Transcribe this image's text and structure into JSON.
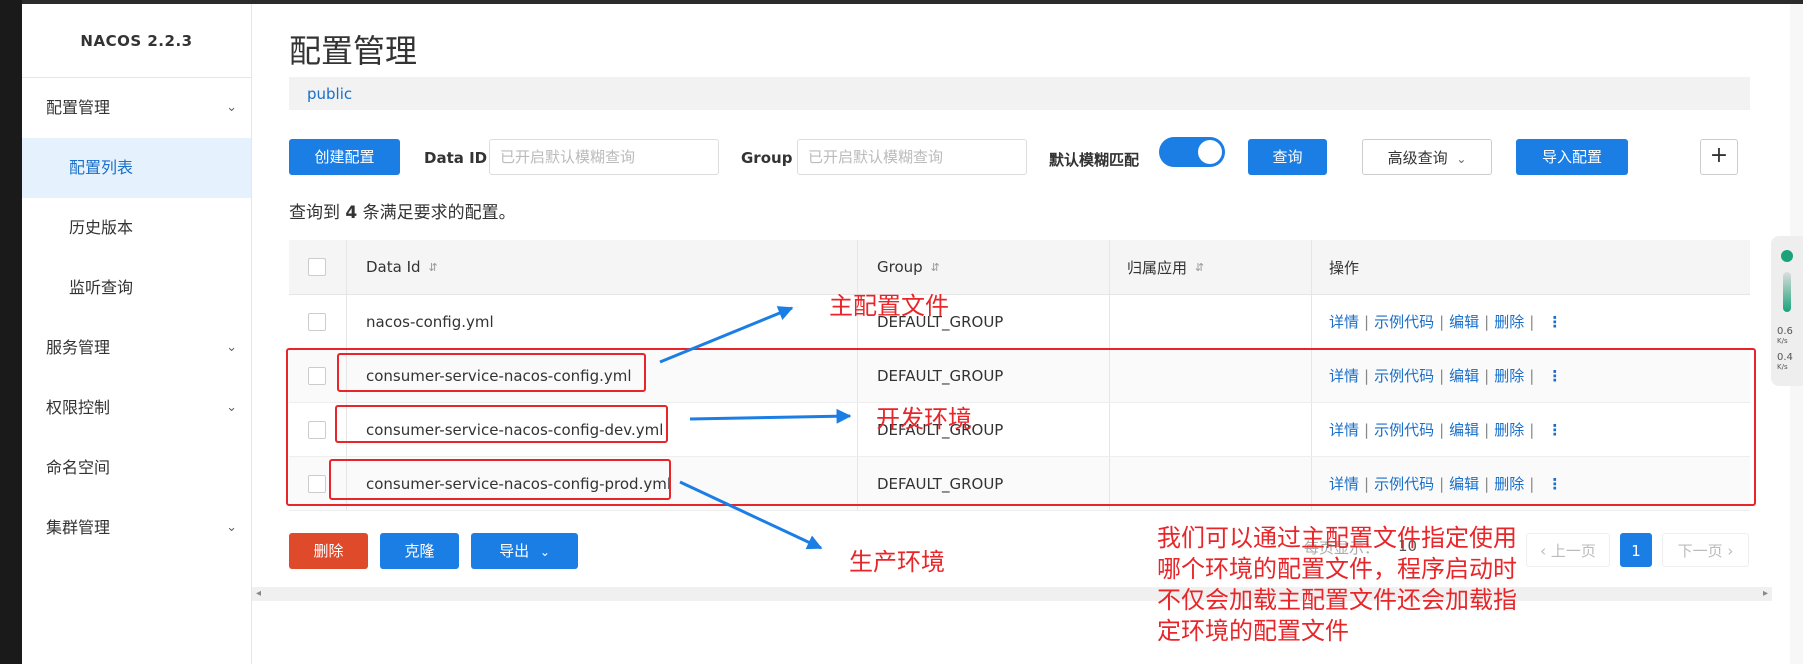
{
  "sidebar": {
    "logo": "NACOS 2.2.3",
    "items": [
      {
        "label": "配置管理",
        "chevron": "⌄"
      },
      {
        "label": "配置列表"
      },
      {
        "label": "历史版本"
      },
      {
        "label": "监听查询"
      },
      {
        "label": "服务管理",
        "chevron": "⌄"
      },
      {
        "label": "权限控制",
        "chevron": "⌄"
      },
      {
        "label": "命名空间"
      },
      {
        "label": "集群管理",
        "chevron": "⌄"
      }
    ]
  },
  "header": {
    "title": "配置管理",
    "namespace": "public"
  },
  "toolbar": {
    "create_label": "创建配置",
    "dataid_label": "Data ID",
    "dataid_placeholder": "已开启默认模糊查询",
    "group_label": "Group",
    "group_placeholder": "已开启默认模糊查询",
    "fuzzy_label": "默认模糊匹配",
    "fuzzy_on": true,
    "query_label": "查询",
    "advanced_label": "高级查询",
    "advanced_chevron": "⌄",
    "import_label": "导入配置",
    "plus_label": "+"
  },
  "result": {
    "prefix": "查询到",
    "count": "4",
    "suffix": "条满足要求的配置。"
  },
  "table": {
    "columns": [
      "Data Id",
      "Group",
      "归属应用",
      "操作"
    ],
    "sort_icon": "⇵",
    "rows": [
      {
        "data_id": "nacos-config.yml",
        "group": "DEFAULT_GROUP",
        "app": ""
      },
      {
        "data_id": "consumer-service-nacos-config.yml",
        "group": "DEFAULT_GROUP",
        "app": ""
      },
      {
        "data_id": "consumer-service-nacos-config-dev.yml",
        "group": "DEFAULT_GROUP",
        "app": ""
      },
      {
        "data_id": "consumer-service-nacos-config-prod.yml",
        "group": "DEFAULT_GROUP",
        "app": ""
      }
    ],
    "ops": {
      "detail": "详情",
      "sample": "示例代码",
      "edit": "编辑",
      "delete": "删除",
      "sep": "|",
      "more": "⋮"
    }
  },
  "bottom": {
    "delete_label": "删除",
    "clone_label": "克隆",
    "export_label": "导出",
    "export_chevron": "⌄",
    "page_size_label": "每页显示：",
    "page_size": "10",
    "prev_label": "‹ 上一页",
    "current_page": "1",
    "next_label": "下一页 ›"
  },
  "widget": {
    "v1": "0.6",
    "v2": "0.4",
    "unit": "K/s"
  },
  "annotations": {
    "main_config": "主配置文件",
    "dev_env": "开发环境",
    "prod_env": "生产环境",
    "note_lines": [
      "我们可以通过主配置文件指定使用",
      "哪个环境的配置文件，程序启动时",
      "不仅会加载主配置文件还会加载指",
      "定环境的配置文件"
    ]
  },
  "colors": {
    "primary": "#1b7ee5",
    "danger": "#df4a2b",
    "annotation": "#e8262a"
  }
}
